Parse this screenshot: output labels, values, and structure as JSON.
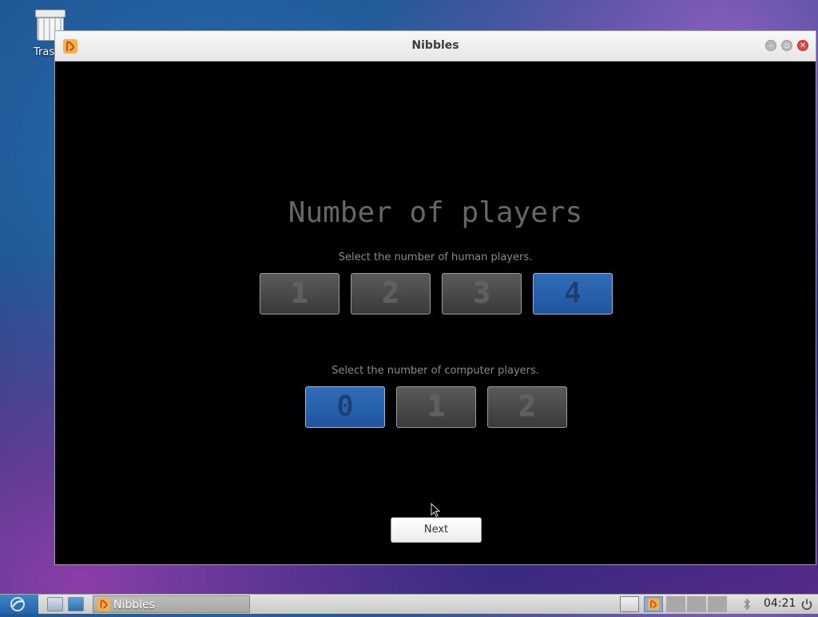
{
  "desktop": {
    "trash_label": "Trash"
  },
  "window": {
    "title": "Nibbles",
    "heading": "Number of players",
    "human_prompt": "Select the number of human players.",
    "human_options": [
      "1",
      "2",
      "3",
      "4"
    ],
    "human_selected": "4",
    "computer_prompt": "Select the number of computer players.",
    "computer_options": [
      "0",
      "1",
      "2"
    ],
    "computer_selected": "0",
    "next_label": "Next"
  },
  "taskbar": {
    "task_label": "Nibbles",
    "clock": "04:21"
  },
  "colors": {
    "selected_button": "#2563ad",
    "unselected_button": "#4a4a4a",
    "window_background": "#000000"
  },
  "icons": [
    "trash-icon",
    "nibbles-app-icon",
    "minimize-icon",
    "maximize-icon",
    "close-icon",
    "start-menu-icon",
    "show-desktop-icon",
    "file-manager-icon",
    "browser-icon",
    "bluetooth-icon",
    "power-icon",
    "mouse-cursor-icon"
  ]
}
